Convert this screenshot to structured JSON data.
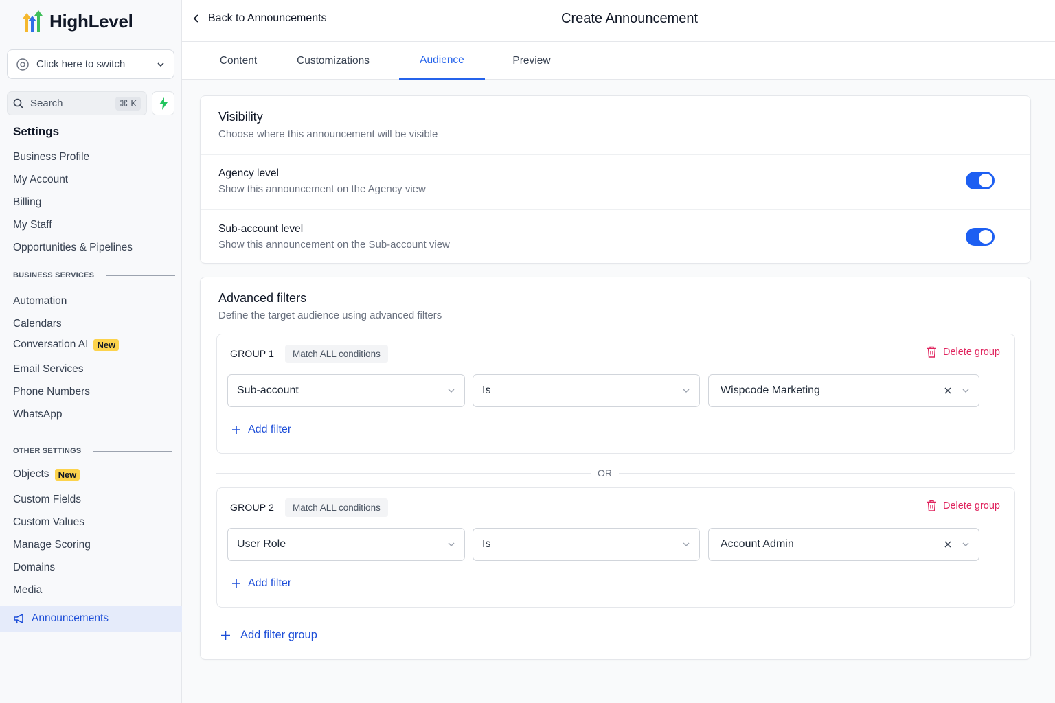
{
  "brand": {
    "name": "HighLevel"
  },
  "switcher": {
    "label": "Click here to switch"
  },
  "search": {
    "label": "Search",
    "shortcut": "⌘ K"
  },
  "sidebar": {
    "title": "Settings",
    "items_top": [
      "Business Profile",
      "My Account",
      "Billing",
      "My Staff",
      "Opportunities & Pipelines"
    ],
    "section_business": "BUSINESS SERVICES",
    "items_business": [
      "Automation",
      "Calendars",
      "Conversation AI",
      "Email Services",
      "Phone Numbers",
      "WhatsApp"
    ],
    "section_other": "OTHER SETTINGS",
    "items_other": [
      "Objects",
      "Custom Fields",
      "Custom Values",
      "Manage Scoring",
      "Domains",
      "Media"
    ],
    "badge_new": "New",
    "active_item": "Announcements"
  },
  "header": {
    "back_label": "Back to Announcements",
    "title": "Create Announcement"
  },
  "tabs": [
    {
      "label": "Content"
    },
    {
      "label": "Customizations"
    },
    {
      "label": "Audience"
    },
    {
      "label": "Preview"
    }
  ],
  "active_tab": "Audience",
  "visibility": {
    "title": "Visibility",
    "subtitle": "Choose where this announcement will be visible",
    "agency": {
      "title": "Agency level",
      "subtitle": "Show this announcement on the Agency view",
      "enabled": true
    },
    "subaccount": {
      "title": "Sub-account level",
      "subtitle": "Show this announcement on the Sub-account view",
      "enabled": true
    }
  },
  "advanced": {
    "title": "Advanced filters",
    "subtitle": "Define the target audience using advanced filters",
    "or_label": "OR",
    "delete_label": "Delete group",
    "match_label": "Match ALL conditions",
    "add_filter_label": "Add filter",
    "add_group_label": "Add filter group",
    "groups": [
      {
        "label": "GROUP 1",
        "field": "Sub-account",
        "operator": "Is",
        "value": "Wispcode Marketing"
      },
      {
        "label": "GROUP 2",
        "field": "User Role",
        "operator": "Is",
        "value": "Account Admin"
      }
    ]
  },
  "colors": {
    "accent": "#1d5ff2",
    "danger": "#e0245e",
    "badge": "#fcd34d",
    "active_bg": "#e5ebfa"
  }
}
